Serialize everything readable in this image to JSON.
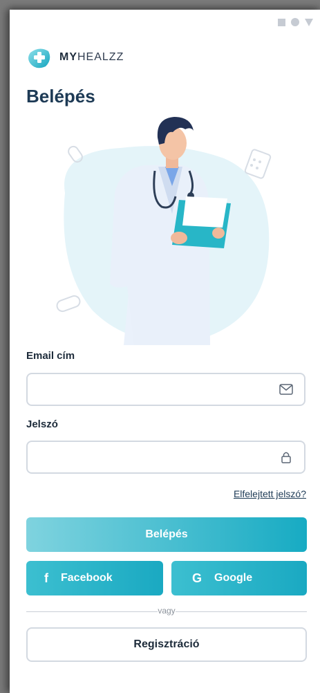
{
  "app": {
    "logo_prefix": "MY",
    "logo_rest": "HEALZZ"
  },
  "page": {
    "title": "Belépés"
  },
  "form": {
    "email_label": "Email cím",
    "email_value": "",
    "password_label": "Jelszó",
    "password_value": "",
    "forgot_link": "Elfelejtett jelszó?"
  },
  "actions": {
    "login_label": "Belépés",
    "facebook_label": "Facebook",
    "facebook_icon": "f",
    "google_label": "Google",
    "google_icon": "G",
    "divider_text": "vagy",
    "register_label": "Regisztráció"
  },
  "colors": {
    "primary": "#17abc3",
    "primary_light": "#7fd3df",
    "title": "#1d3a55"
  },
  "icons": {
    "email": "envelope-icon",
    "password": "lock-icon",
    "status": [
      "square-icon",
      "circle-icon",
      "triangle-icon"
    ]
  }
}
